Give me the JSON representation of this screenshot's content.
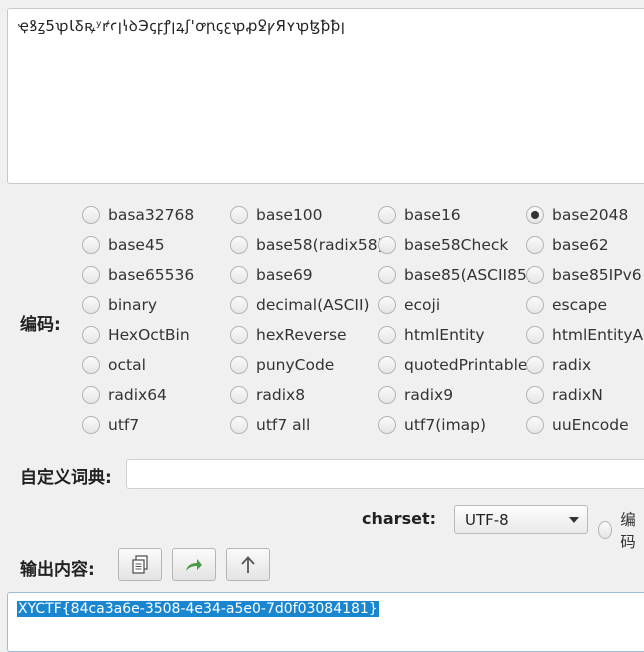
{
  "input": {
    "text": "ҿꝸꙁ5ꝕꙆꝽꝶʸꝵꜥꞁꝇꝺЭꞔꝼꝭꞁꝝʃꞌꝍꞃꞔꜫꝕꝓꝿꝩЯʏꝕꜩꝥꝥꞁ"
  },
  "encoding": {
    "label": "编码:",
    "columns": [
      [
        "basa32768",
        "base45",
        "base65536",
        "binary",
        "HexOctBin",
        "octal",
        "radix64",
        "utf7"
      ],
      [
        "base100",
        "base58(radix58)",
        "base69",
        "decimal(ASCII)",
        "hexReverse",
        "punyCode",
        "radix8",
        "utf7 all"
      ],
      [
        "base16",
        "base58Check",
        "base85(ASCII85)",
        "ecoji",
        "htmlEntity",
        "quotedPrintable",
        "radix9",
        "utf7(imap)"
      ],
      [
        "base2048",
        "base62",
        "base85IPv6",
        "escape",
        "htmlEntityAll",
        "radix",
        "radixN",
        "uuEncode"
      ]
    ],
    "selected": "base2048"
  },
  "dictionary": {
    "label": "自定义词典:",
    "value": ""
  },
  "charset": {
    "label": "charset:",
    "selected": "UTF-8",
    "radio_label": "编码"
  },
  "output": {
    "label": "输出内容:",
    "text": "XYCTF{84ca3a6e-3508-4e34-a5e0-7d0f03084181}",
    "buttons": [
      {
        "name": "copy-icon",
        "color": "#555555"
      },
      {
        "name": "share-arrow-icon",
        "color": "#4a9a4a"
      },
      {
        "name": "up-arrow-icon",
        "color": "#555555"
      }
    ]
  }
}
